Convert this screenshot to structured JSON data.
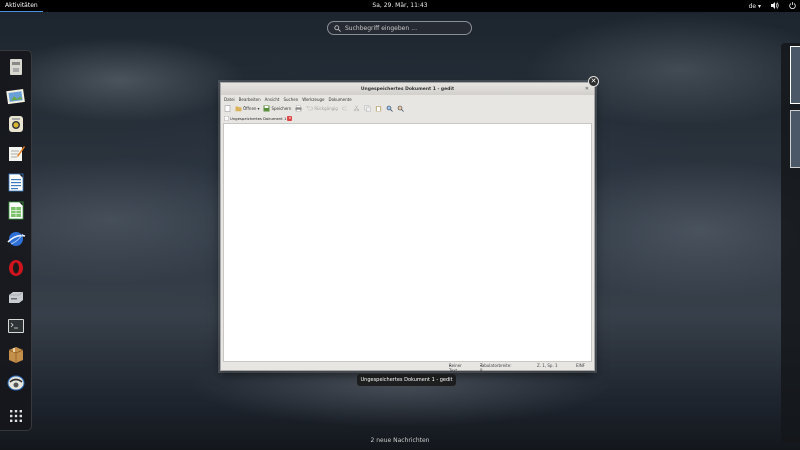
{
  "topbar": {
    "activities": "Aktivitäten",
    "clock": "Sa, 29. Mär, 11:43",
    "keyboard_layout": "de",
    "keyboard_arrow": "▾",
    "volume_icon": "volume-icon",
    "power_icon": "power-icon"
  },
  "search": {
    "placeholder": "Suchbegriff eingeben …"
  },
  "dash": {
    "items": [
      "files-app-icon",
      "image-viewer-icon",
      "rhythmbox-icon",
      "text-editor-icon",
      "writer-icon",
      "calc-icon",
      "browser-icon",
      "opera-icon",
      "disk-utility-icon",
      "terminal-icon",
      "archive-manager-icon",
      "ekiga-icon",
      "show-applications-icon"
    ]
  },
  "window": {
    "title": "Ungespeichertes Dokument 1 - gedit",
    "menu": [
      "Datei",
      "Bearbeiten",
      "Ansicht",
      "Suchen",
      "Werkzeuge",
      "Dokumente"
    ],
    "toolbar": {
      "open": "Öffnen",
      "save": "Speichern",
      "undo": "Rückgängig"
    },
    "tab_label": "Ungespeichertes Dokument 1",
    "status": {
      "syntax": "Reiner Text",
      "tab_width": "Tabulatorbreite: 8",
      "position": "Z. 1, Sp. 1",
      "insert_mode": "EINF"
    }
  },
  "caption": "Ungespeichertes Dokument 1 - gedit",
  "notification": "2 neue Nachrichten"
}
